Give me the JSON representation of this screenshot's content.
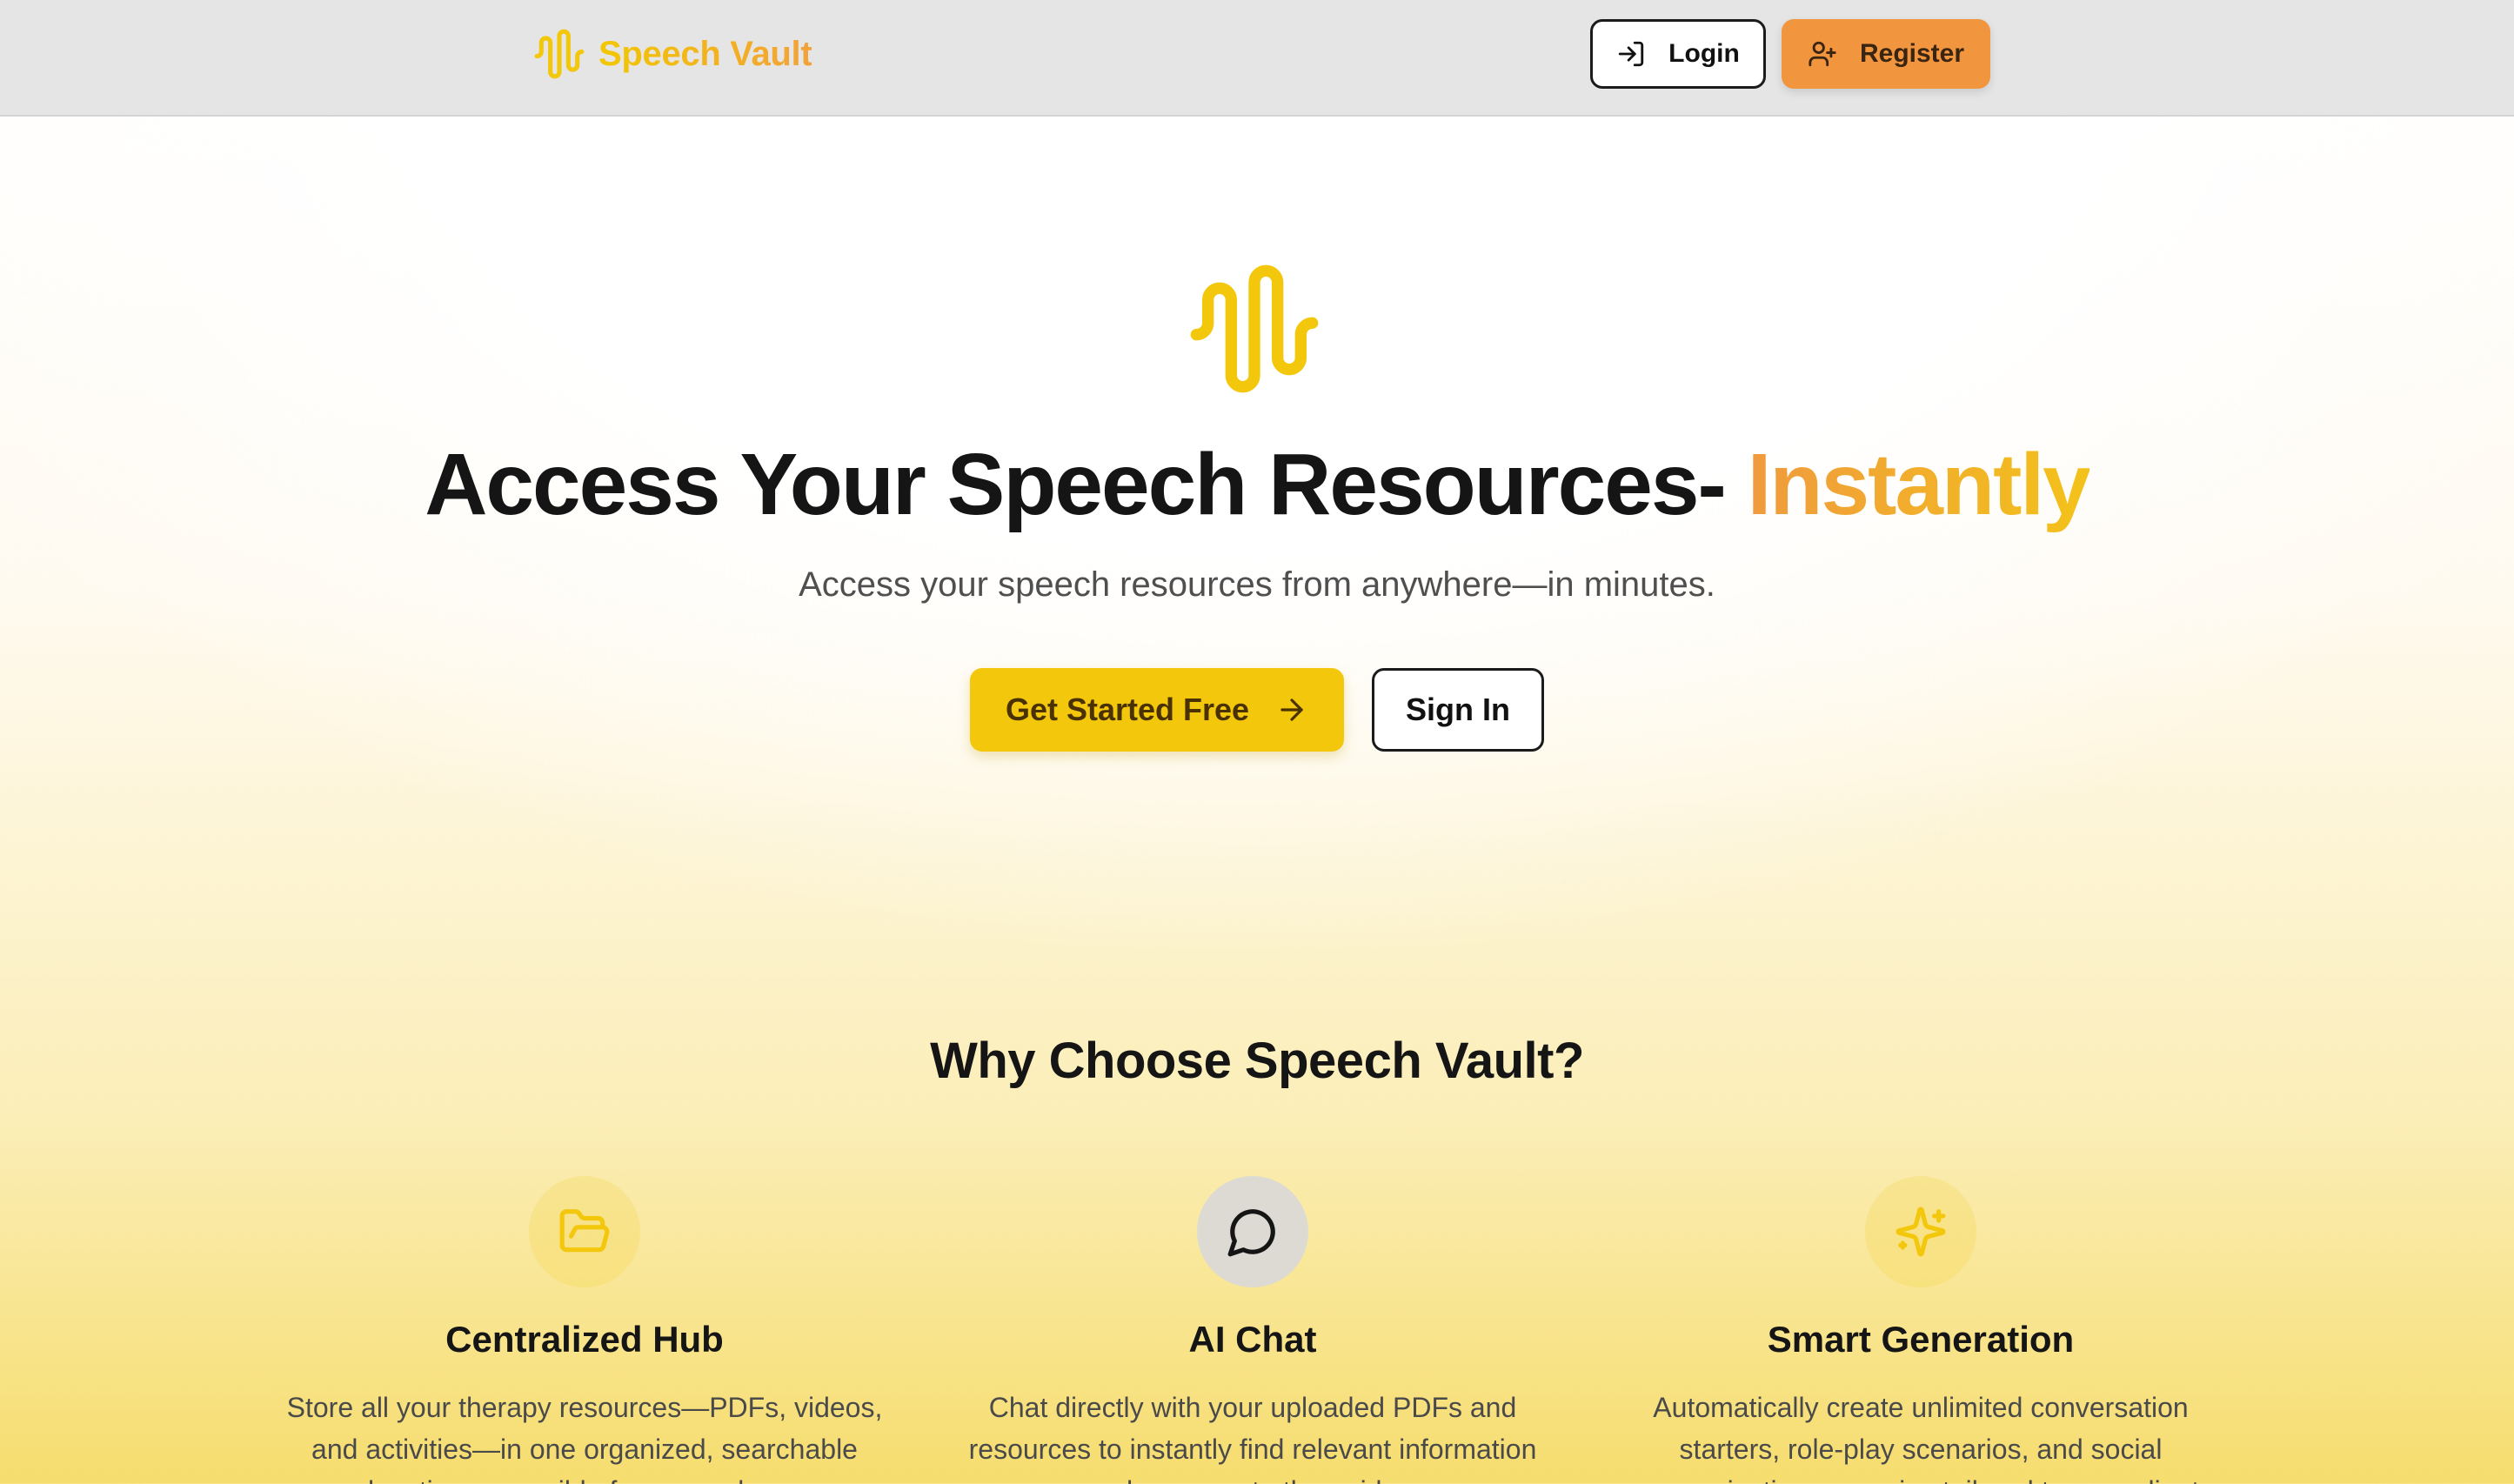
{
  "nav": {
    "brand_name": "Speech Vault",
    "brand_icon": "audio-waveform-icon",
    "login_label": "Login",
    "login_icon": "log-in-icon",
    "register_label": "Register",
    "register_icon": "user-plus-icon"
  },
  "hero": {
    "icon": "audio-waveform-icon",
    "title_main": "Access Your Speech Resources- ",
    "title_accent": "Instantly",
    "subtitle": "Access your speech resources from anywhere—in minutes.",
    "cta_primary": "Get Started Free",
    "cta_primary_icon": "arrow-right-icon",
    "cta_secondary": "Sign In"
  },
  "features": {
    "title": "Why Choose Speech Vault?",
    "items": [
      {
        "icon": "folder-open-icon",
        "title": "Centralized Hub",
        "description": "Store all your therapy resources—PDFs, videos, and activities—in one organized, searchable location accessible from anywhere."
      },
      {
        "icon": "message-circle-icon",
        "title": "AI Chat",
        "description": "Chat directly with your uploaded PDFs and resources to instantly find relevant information and answers to the guides."
      },
      {
        "icon": "sparkles-icon",
        "title": "Smart Generation",
        "description": "Automatically create unlimited conversation starters, role-play scenarios, and social communication scenarios tailored to your clients."
      }
    ]
  },
  "colors": {
    "brand_yellow": "#f2c70c",
    "brand_orange": "#f2953f",
    "navbar_bg": "#e5e5e5",
    "text_dark": "#151515"
  }
}
